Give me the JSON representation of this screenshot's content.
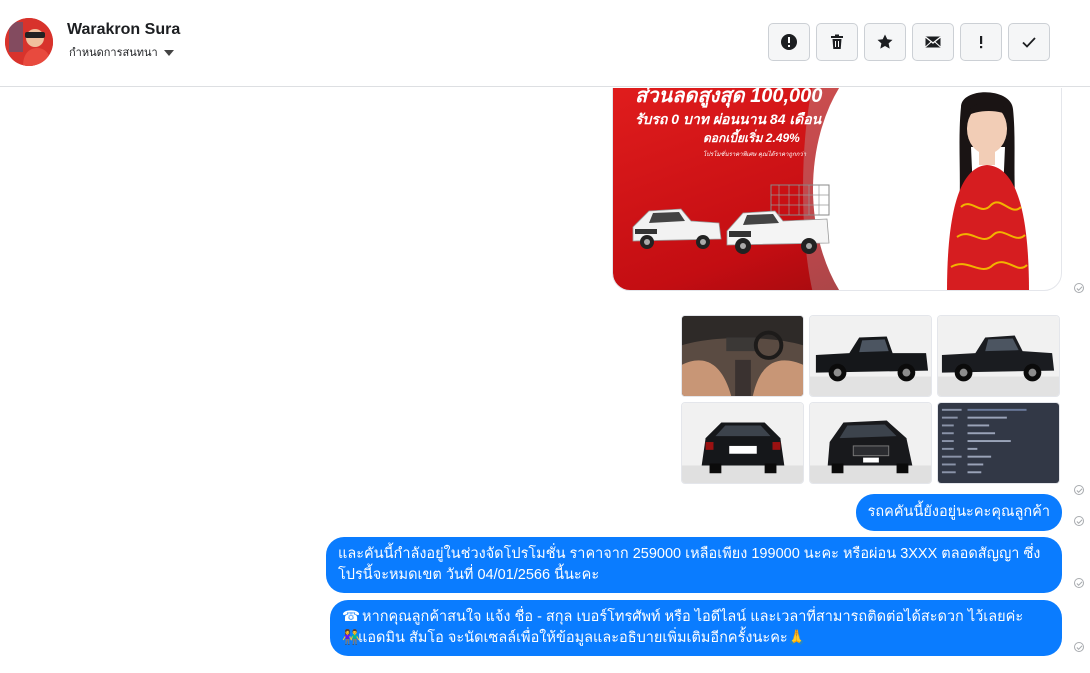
{
  "header": {
    "contact_name": "Warakron Sura",
    "assign_label": "กำหนดการสนทนา",
    "toolbar": [
      {
        "name": "report-spam-button",
        "icon": "alert-circle-icon"
      },
      {
        "name": "delete-button",
        "icon": "trash-icon"
      },
      {
        "name": "star-button",
        "icon": "star-icon"
      },
      {
        "name": "mark-unread-button",
        "icon": "envelope-icon"
      },
      {
        "name": "follow-up-button",
        "icon": "exclamation-icon"
      },
      {
        "name": "mark-done-button",
        "icon": "checkmark-icon"
      }
    ]
  },
  "promo": {
    "line1": "ส่วนลดสูงสุด 100,000",
    "line2": "รับรถ 0 บาท ผ่อนนาน 84 เดือน",
    "line3": "ดอกเบี้ยเริ่ม 2.49%",
    "line4": "โปรโมชั่นราคาพิเศษ คุณได้ราคาถูกกว่า"
  },
  "messages": [
    {
      "text": "รถคคันนี้ยังอยู่นะคะคุณลูกค้า"
    },
    {
      "text": "และคันนี้กำลังอยู่ในช่วงจัดโปรโมชั่น ราคาจาก 259000 เหลือเพียง 199000  นะคะ หรือผ่อน 3XXX ตลอดสัญญา ซึ่งโปรนี้จะหมดเขต วันที่ 04/01/2566 นี้นะคะ"
    },
    {
      "text": "หากคุณลูกค้าสนใจ แจ้ง ชื่อ - สกุล เบอร์โทรศัพท์ หรือ ไอดีไลน์ และเวลาที่สามารถติดต่อได้สะดวก ไว้เลยค่ะ",
      "text2": "แอดมิน สัมโอ จะนัดเซลล์เพื่อให้ข้อมูลและอธิบายเพิ่มเติมอีกครั้งนะคะ"
    }
  ],
  "colors": {
    "accent": "#0a7cff",
    "promo_red": "#d4141a"
  }
}
